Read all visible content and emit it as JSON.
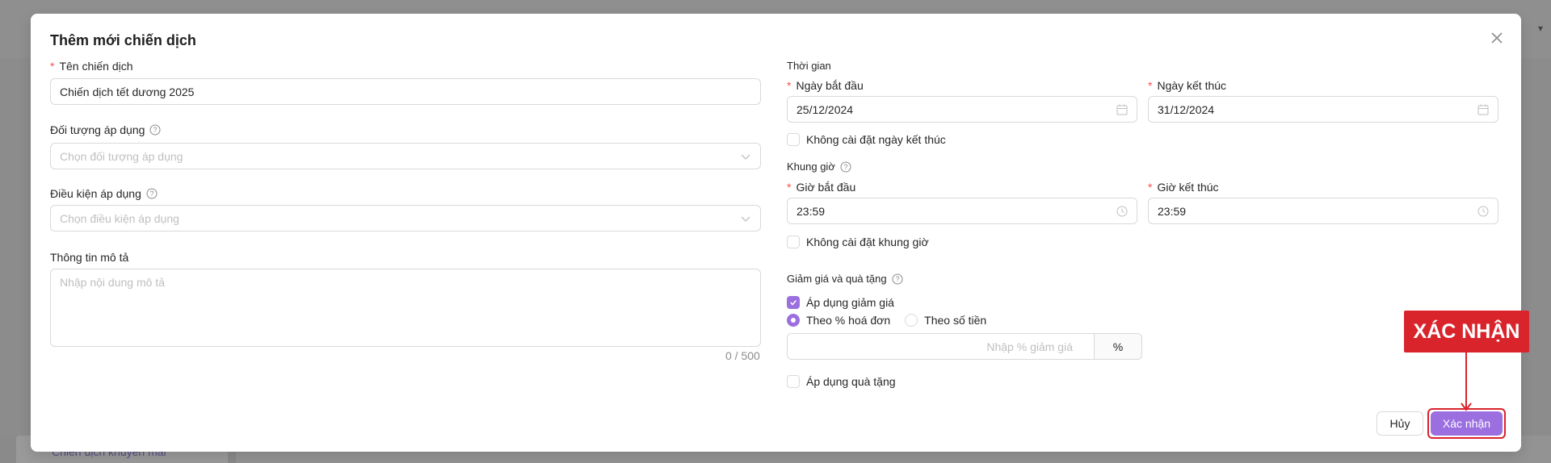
{
  "background": {
    "link_text": "Chiến dịch khuyến mãi"
  },
  "modal": {
    "title": "Thêm mới chiến dịch",
    "close_icon": "close-icon",
    "left": {
      "name": {
        "label": "Tên chiến dịch",
        "value": "Chiến dịch tết dương 2025"
      },
      "target": {
        "label": "Đối tượng áp dụng",
        "placeholder": "Chọn đối tượng áp dụng"
      },
      "condition": {
        "label": "Điều kiện áp dụng",
        "placeholder": "Chọn điều kiện áp dụng"
      },
      "description": {
        "label": "Thông tin mô tả",
        "placeholder": "Nhập nội dung mô tả",
        "counter": "0 / 500"
      }
    },
    "right": {
      "time_section": "Thời gian",
      "start_date": {
        "label": "Ngày bắt đầu",
        "value": "25/12/2024"
      },
      "end_date": {
        "label": "Ngày kết thúc",
        "value": "31/12/2024"
      },
      "no_end_date": "Không cài đặt ngày kết thúc",
      "timeframe_section": "Khung giờ",
      "start_time": {
        "label": "Giờ bắt đầu",
        "value": "23:59"
      },
      "end_time": {
        "label": "Giờ kết thúc",
        "value": "23:59"
      },
      "no_timeframe": "Không cài đặt khung giờ",
      "discount_section": "Giảm giá và quà tặng",
      "apply_discount": {
        "label": "Áp dụng giảm giá",
        "checked": true
      },
      "discount_type": {
        "options": [
          "Theo % hoá đơn",
          "Theo số tiền"
        ],
        "selected": "Theo % hoá đơn"
      },
      "discount_input": {
        "placeholder": "Nhập % giảm giá",
        "addon": "%"
      },
      "apply_gift": {
        "label": "Áp dụng quà tặng",
        "checked": false
      }
    },
    "footer": {
      "cancel_label": "Hủy",
      "confirm_label": "Xác nhận"
    }
  },
  "annotation": {
    "callout_text": "XÁC NHẬN",
    "color": "#d9242c"
  },
  "colors": {
    "accent": "#9b6fe0",
    "required": "#ff4d4f"
  }
}
